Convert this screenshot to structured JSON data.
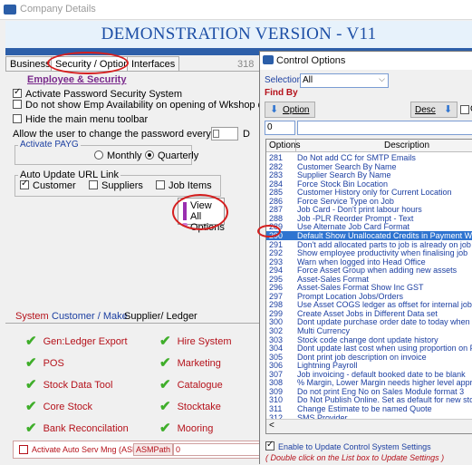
{
  "main": {
    "title": "Company Details",
    "banner": "DEMONSTRATION VERSION - V11",
    "tabs": [
      "Business",
      "Security / Options",
      "Interfaces"
    ],
    "partial_number": "318",
    "section_heading": "Employee & Security",
    "checks": [
      {
        "label": "Activate Password Security System",
        "checked": true
      },
      {
        "label": "Do not show Emp Availability on opening of Wkshop diary/E",
        "checked": false
      },
      {
        "label": "Hide the main menu toolbar",
        "checked": false
      }
    ],
    "password_change_label": "Allow the user to change the password every",
    "password_change_value": "",
    "password_change_suffix": "D",
    "payg": {
      "legend": "Activate PAYG",
      "options": [
        "Monthly",
        "Quarterly"
      ],
      "selected": "Quarterly"
    },
    "url_link": {
      "legend": "Auto Update URL Link",
      "options": [
        {
          "label": "Customer",
          "checked": true
        },
        {
          "label": "Suppliers",
          "checked": false
        },
        {
          "label": "Job Items",
          "checked": false
        }
      ]
    },
    "view_all_line1": "View All",
    "view_all_line2": "Options",
    "system_tabs": [
      "System",
      "Customer / Make",
      "Supplier/ Ledger"
    ],
    "modules_left": [
      "Gen:Ledger Export",
      "POS",
      "Stock Data Tool",
      "Core Stock",
      "Bank Reconcilation"
    ],
    "modules_right": [
      "Hire System",
      "Marketing",
      "Catalogue",
      "Stocktake",
      "Mooring"
    ],
    "asm_label": "Activate Auto Serv Mng (ASM)",
    "asm_path_label": "ASMPath",
    "asm_path_value": "0"
  },
  "control_options": {
    "title": "Control Options",
    "selection_label": "Selection:",
    "selection_value": "All",
    "find_by_label": "Find By",
    "option_button": "Option",
    "desc_button": "Desc",
    "extra_button_label": "C",
    "search_value": "0",
    "col_options": "Options",
    "col_description": "Description",
    "selected_option": "290",
    "rows": [
      {
        "o": "281",
        "d": "Do Not add CC for SMTP Emails"
      },
      {
        "o": "282",
        "d": "Customer Search By Name"
      },
      {
        "o": "283",
        "d": "Supplier Search By Name"
      },
      {
        "o": "284",
        "d": "Force Stock Bin Location"
      },
      {
        "o": "285",
        "d": "Customer History only for Current Location"
      },
      {
        "o": "286",
        "d": "Force Service Type on Job"
      },
      {
        "o": "287",
        "d": "Job Card - Don't print labour hours"
      },
      {
        "o": "288",
        "d": "Job -PLR Reorder Prompt - Text"
      },
      {
        "o": "289",
        "d": "Use Alternate Job Card Format"
      },
      {
        "o": "290",
        "d": "Default Show Unallocated Credits in Payment Window"
      },
      {
        "o": "291",
        "d": "Don't add allocated parts to job is already on job"
      },
      {
        "o": "292",
        "d": "Show employee productivity when finalising job"
      },
      {
        "o": "293",
        "d": "Warn when logged into Head Office"
      },
      {
        "o": "294",
        "d": "Force Asset Group when adding new assets"
      },
      {
        "o": "295",
        "d": "Asset-Sales Format"
      },
      {
        "o": "296",
        "d": "Asset-Sales Format Show Inc GST"
      },
      {
        "o": "297",
        "d": "Prompt Location Jobs/Orders"
      },
      {
        "o": "298",
        "d": "Use Asset COGS ledger as offset for internal jobs"
      },
      {
        "o": "299",
        "d": "Create Asset Jobs in Different Data set"
      },
      {
        "o": "300",
        "d": "Dont update purchase order date to today when oper"
      },
      {
        "o": "302",
        "d": "Multi Currency"
      },
      {
        "o": "303",
        "d": "Stock code change dont update history"
      },
      {
        "o": "304",
        "d": "Dont update last cost when using proportion on PO"
      },
      {
        "o": "305",
        "d": "Dont print job description on invoice"
      },
      {
        "o": "306",
        "d": "Lightning Payroll"
      },
      {
        "o": "307",
        "d": "Job invoicing - default booked date to be blank"
      },
      {
        "o": "308",
        "d": "% Margin, Lower Margin needs higher level approval"
      },
      {
        "o": "309",
        "d": "Do not print Eng No on Sales Module format 3"
      },
      {
        "o": "310",
        "d": "Do Not Publish Online. Set as default for new stock"
      },
      {
        "o": "311",
        "d": "Change Estimate to be named Quote"
      },
      {
        "o": "312",
        "d": "SMS Provider"
      }
    ],
    "enable_label": "Enable to Update Control System Settings",
    "hint": "( Double click on the List box to Update Settings )"
  },
  "colors": {
    "accent_blue": "#2d5fa9",
    "selection_blue": "#2f74d0",
    "annotation_red": "#d51f1f",
    "module_red": "#b5121b",
    "check_green": "#3fae2a"
  }
}
